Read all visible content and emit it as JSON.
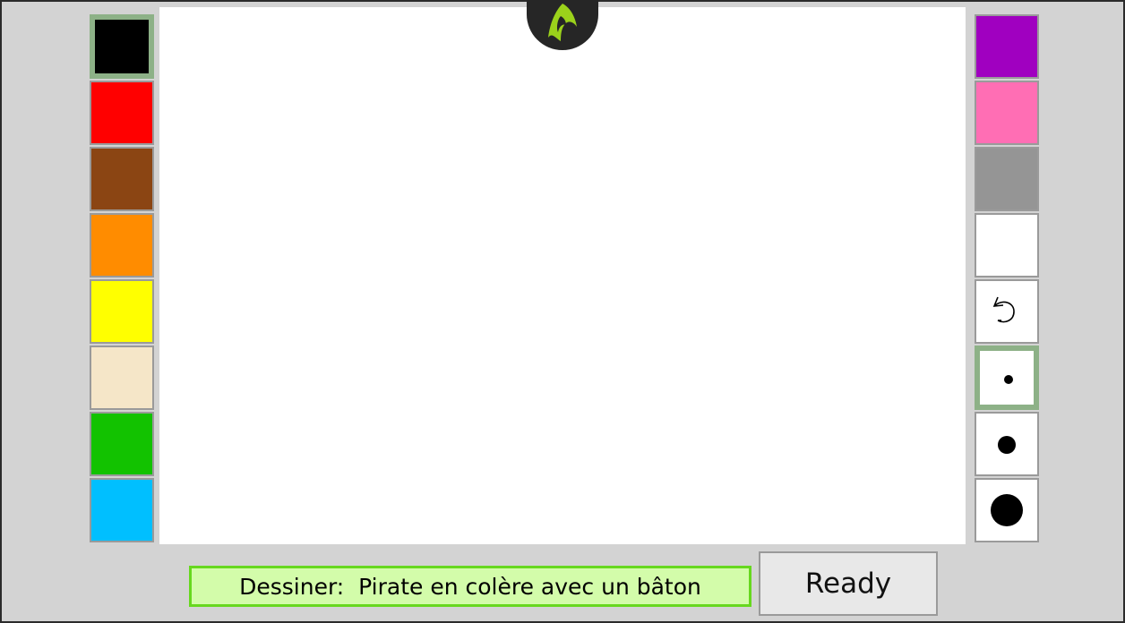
{
  "palette_left": [
    {
      "name": "black",
      "color": "#000000",
      "selected": true
    },
    {
      "name": "red",
      "color": "#ff0000",
      "selected": false
    },
    {
      "name": "brown",
      "color": "#8b4513",
      "selected": false
    },
    {
      "name": "orange",
      "color": "#ff8c00",
      "selected": false
    },
    {
      "name": "yellow",
      "color": "#ffff00",
      "selected": false
    },
    {
      "name": "beige",
      "color": "#f5e6c8",
      "selected": false
    },
    {
      "name": "green",
      "color": "#12c200",
      "selected": false
    },
    {
      "name": "sky-blue",
      "color": "#00bfff",
      "selected": false
    }
  ],
  "palette_right": [
    {
      "name": "purple",
      "color": "#a000c0",
      "selected": false
    },
    {
      "name": "pink",
      "color": "#ff6eb4",
      "selected": false
    },
    {
      "name": "gray",
      "color": "#959595",
      "selected": false
    },
    {
      "name": "white",
      "color": "#ffffff",
      "selected": false
    }
  ],
  "tools": {
    "undo_icon": "undo-icon",
    "brush_sizes": [
      {
        "name": "small",
        "selected": true
      },
      {
        "name": "medium",
        "selected": false
      },
      {
        "name": "large",
        "selected": false
      }
    ]
  },
  "logo_icon": "app-logo-icon",
  "prompt": {
    "text": "Dessiner:  Pirate en colère avec un bâton"
  },
  "ready_button": {
    "label": "Ready"
  },
  "colors": {
    "background": "#d3d3d3",
    "selected_border": "#8db187",
    "prompt_background": "#d3fcaa",
    "prompt_border": "#66d81e",
    "logo_green": "#9bd21b"
  }
}
